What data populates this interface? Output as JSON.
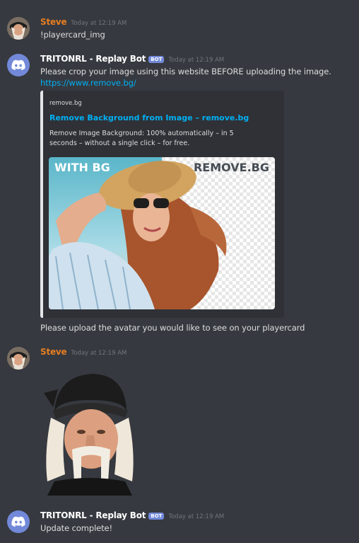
{
  "messages": [
    {
      "author": "Steve",
      "timestamp": "Today at 12:19 AM",
      "text": "!playercard_img"
    },
    {
      "author": "TRITONRL - Replay Bot",
      "badge": "BOT",
      "timestamp": "Today at 12:19 AM",
      "text": "Please crop your image using this website BEFORE uploading the image.",
      "link": "https://www.remove.bg/",
      "embed": {
        "provider": "remove.bg",
        "title": "Remove Background from Image – remove.bg",
        "description": "Remove Image Background: 100% automatically – in 5 seconds – without a single click – for free.",
        "image_left_label": "WITH BG",
        "image_right_label": "REMOVE.BG"
      },
      "followup": "Please upload the avatar you would like to see on your playercard"
    },
    {
      "author": "Steve",
      "timestamp": "Today at 12:19 AM",
      "attachment_icon": "uploaded-avatar-image"
    },
    {
      "author": "TRITONRL - Replay Bot",
      "badge": "BOT",
      "timestamp": "Today at 12:19 AM",
      "text": "Update complete!"
    }
  ],
  "colors": {
    "background": "#36393f",
    "embed_background": "#2f3136",
    "user_name": "#e67e22",
    "bot_badge": "#7289da",
    "link": "#00b0f4",
    "timestamp": "#72767d"
  }
}
